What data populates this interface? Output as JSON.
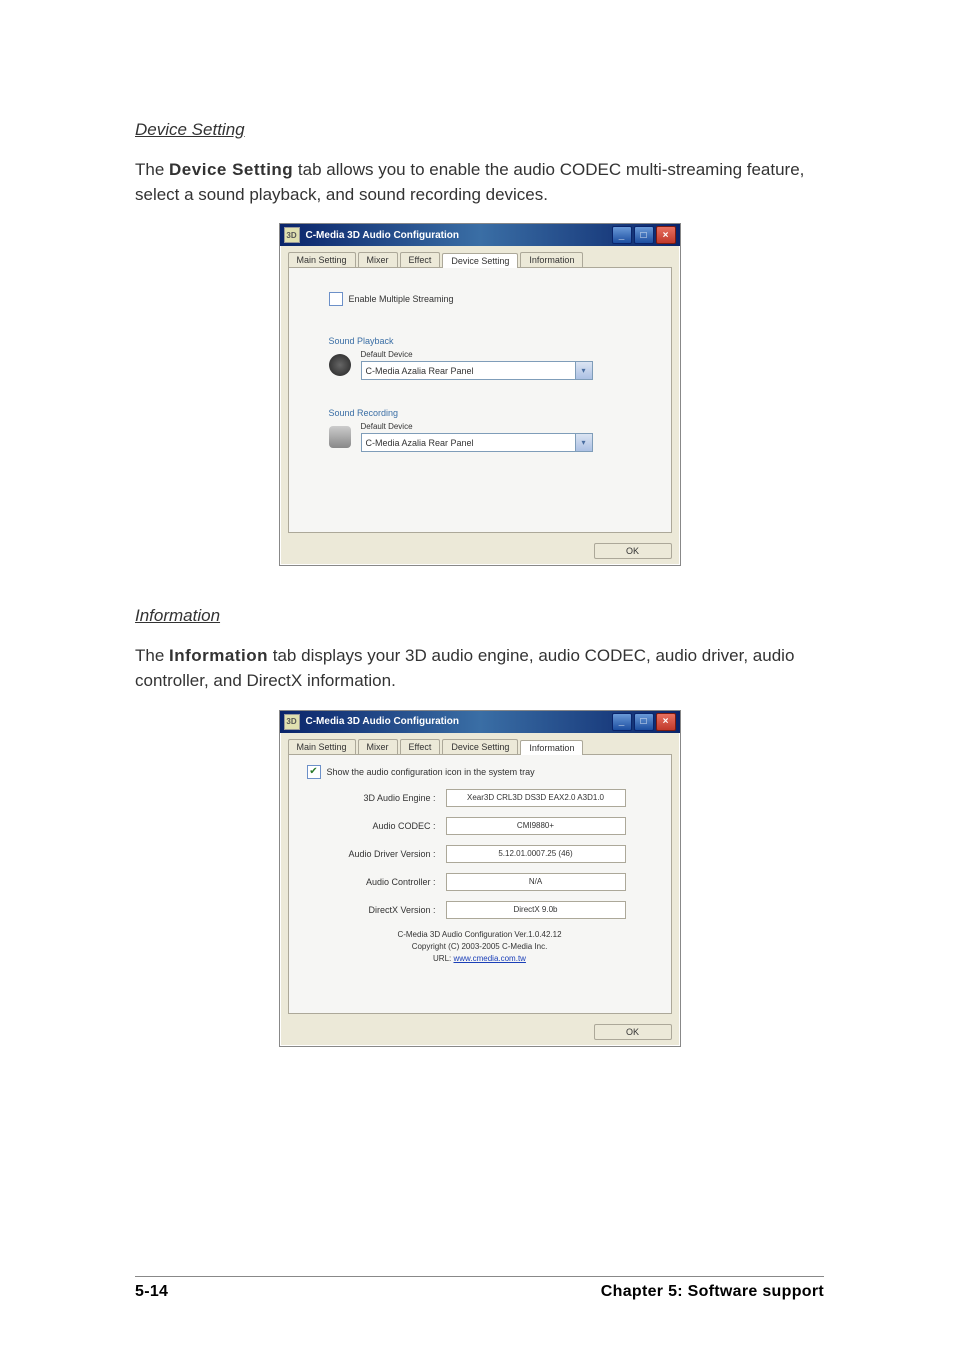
{
  "section1": {
    "heading": "Device Setting",
    "intro_pre": "The ",
    "intro_bold": "Device Setting",
    "intro_post": " tab allows you to enable the audio CODEC multi-streaming feature, select a sound playback, and sound recording devices.",
    "window": {
      "title": "C-Media 3D Audio Configuration",
      "tabs": [
        "Main Setting",
        "Mixer",
        "Effect",
        "Device Setting",
        "Information"
      ],
      "active_tab": "Device Setting",
      "checkbox_label": "Enable Multiple Streaming",
      "playback": {
        "group": "Sound Playback",
        "label": "Default Device",
        "value": "C-Media Azalia Rear Panel"
      },
      "recording": {
        "group": "Sound Recording",
        "label": "Default Device",
        "value": "C-Media Azalia Rear Panel"
      },
      "ok": "OK"
    }
  },
  "section2": {
    "heading": "Information",
    "intro_pre": "The ",
    "intro_bold": "Information",
    "intro_post": " tab displays your 3D audio engine, audio CODEC, audio driver, audio controller, and DirectX information.",
    "window": {
      "title": "C-Media 3D Audio Configuration",
      "tabs": [
        "Main Setting",
        "Mixer",
        "Effect",
        "Device Setting",
        "Information"
      ],
      "active_tab": "Information",
      "checkbox_label": "Show the audio configuration icon in the system tray",
      "rows": [
        {
          "label": "3D Audio Engine :",
          "value": "Xear3D CRL3D DS3D EAX2.0 A3D1.0"
        },
        {
          "label": "Audio CODEC :",
          "value": "CMI9880+"
        },
        {
          "label": "Audio Driver Version :",
          "value": "5.12.01.0007.25 (46)"
        },
        {
          "label": "Audio Controller :",
          "value": "N/A"
        },
        {
          "label": "DirectX Version :",
          "value": "DirectX 9.0b"
        }
      ],
      "copyright1": "C-Media 3D Audio Configuration Ver.1.0.42.12",
      "copyright2": "Copyright (C) 2003-2005 C-Media Inc.",
      "url_label": "URL: ",
      "url": "www.cmedia.com.tw",
      "ok": "OK"
    }
  },
  "footer": {
    "page": "5-14",
    "chapter": "Chapter 5: Software support"
  }
}
